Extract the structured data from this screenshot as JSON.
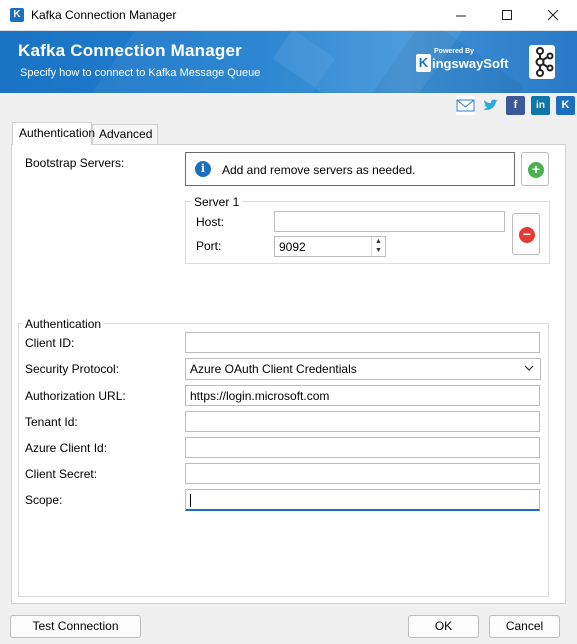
{
  "window": {
    "title": "Kafka Connection Manager"
  },
  "banner": {
    "title": "Kafka Connection Manager",
    "subtitle": "Specify how to connect to Kafka Message Queue",
    "logo_powered": "Powered By",
    "logo_k": "K",
    "logo_name": "ingswaySoft"
  },
  "social": [
    "email-icon",
    "twitter-icon",
    "facebook-icon",
    "linkedin-icon",
    "kingswaysoft-icon"
  ],
  "tabs": [
    {
      "label": "Authentication",
      "active": true
    },
    {
      "label": "Advanced",
      "active": false
    }
  ],
  "bootstrap": {
    "label": "Bootstrap Servers:",
    "info": "Add and remove servers as needed.",
    "server_title": "Server 1",
    "host_label": "Host:",
    "host_value": "",
    "port_label": "Port:",
    "port_value": "9092"
  },
  "auth": {
    "group_title": "Authentication",
    "client_id_label": "Client ID:",
    "client_id_value": "",
    "security_protocol_label": "Security Protocol:",
    "security_protocol_value": "Azure OAuth Client Credentials",
    "authorization_url_label": "Authorization URL:",
    "authorization_url_value": "https://login.microsoft.com",
    "tenant_id_label": "Tenant Id:",
    "tenant_id_value": "",
    "azure_client_id_label": "Azure Client Id:",
    "azure_client_id_value": "",
    "client_secret_label": "Client Secret:",
    "client_secret_value": "",
    "scope_label": "Scope:",
    "scope_value": ""
  },
  "buttons": {
    "test_connection": "Test Connection",
    "ok": "OK",
    "cancel": "Cancel"
  },
  "colors": {
    "banner_blue": "#1f7fcf",
    "add_green": "#4caf50",
    "remove_red": "#e53935",
    "focus_blue": "#1c6fc0"
  }
}
